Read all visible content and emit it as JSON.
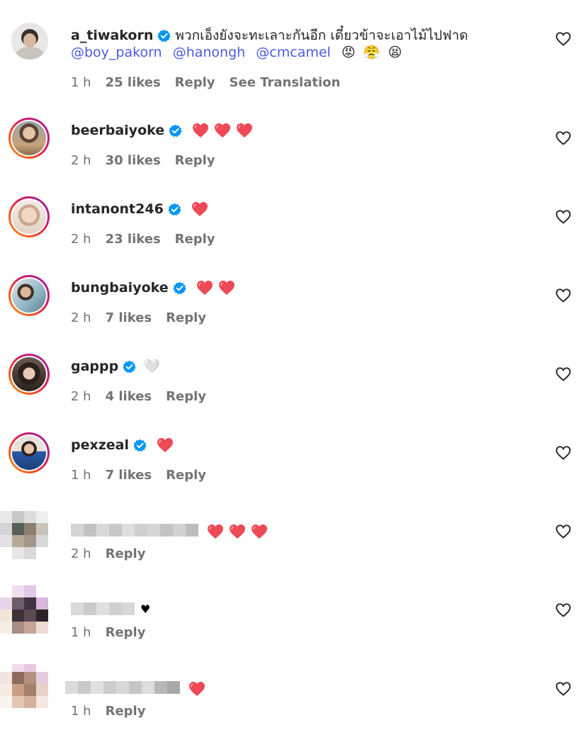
{
  "comments": [
    {
      "username": "a_tiwakorn",
      "text": "พวกเอ็งยังจะทะเลาะกันอีก เดี๋ยวข้าจะเอาไม้ไปฟาด",
      "mentions": [
        "@boy_pakorn",
        "@hanongh",
        "@cmcamel"
      ],
      "emojis": [
        "😡",
        "😤",
        "😫"
      ],
      "time": "1 h",
      "likes": "25 likes",
      "reply": "Reply",
      "translate": "See Translation"
    },
    {
      "username": "beerbaiyoke",
      "hearts": 3,
      "time": "2 h",
      "likes": "30 likes",
      "reply": "Reply"
    },
    {
      "username": "intanont246",
      "hearts": 1,
      "time": "2 h",
      "likes": "23 likes",
      "reply": "Reply"
    },
    {
      "username": "bungbaiyoke",
      "hearts": 2,
      "time": "2 h",
      "likes": "7 likes",
      "reply": "Reply"
    },
    {
      "username": "gappp",
      "white_heart": "🤍",
      "time": "2 h",
      "likes": "4 likes",
      "reply": "Reply"
    },
    {
      "username": "pexzeal",
      "hearts": 1,
      "time": "1 h",
      "likes": "7 likes",
      "reply": "Reply"
    },
    {
      "hearts": 3,
      "time": "2 h",
      "reply": "Reply"
    },
    {
      "black_heart": "♥",
      "time": "1 h",
      "reply": "Reply"
    },
    {
      "hearts": 1,
      "time": "1 h",
      "reply": "Reply"
    }
  ],
  "colors": {
    "heart_red": "#ed4956",
    "verified_blue": "#0095f6",
    "mention_blue": "#4a5de3",
    "meta_gray": "#737373"
  }
}
